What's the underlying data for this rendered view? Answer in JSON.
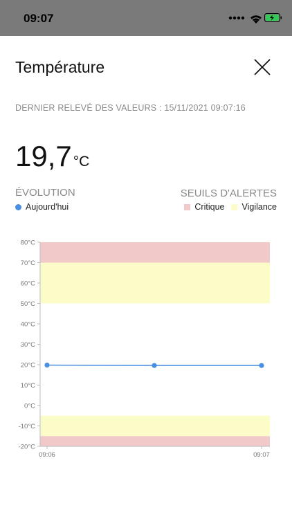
{
  "status_bar": {
    "time": "09:07"
  },
  "header": {
    "title": "Température"
  },
  "last_reading": {
    "text": "DERNIER RELEVÉ DES VALEURS : 15/11/2021 09:07:16"
  },
  "current": {
    "value": "19,7",
    "unit": "°C"
  },
  "evolution": {
    "heading": "ÉVOLUTION",
    "series_label": "Aujourd'hui",
    "series_color": "#4a90e2"
  },
  "thresholds": {
    "heading": "SEUILS D'ALERTES",
    "critical_label": "Critique",
    "critical_color": "#f2c9c9",
    "warning_label": "Vigilance",
    "warning_color": "#fbfcc8"
  },
  "chart_data": {
    "type": "line",
    "x": [
      "09:06",
      "09:06:30",
      "09:07"
    ],
    "x_tick_labels": [
      "09:06",
      "09:07"
    ],
    "series": [
      {
        "name": "Aujourd'hui",
        "values": [
          19.8,
          19.6,
          19.6
        ],
        "color": "#4a90e2"
      }
    ],
    "y_ticks": [
      "80°C",
      "70°C",
      "60°C",
      "50°C",
      "40°C",
      "30°C",
      "20°C",
      "10°C",
      "0°C",
      "-10°C",
      "-20°C"
    ],
    "ylim": [
      -20,
      80
    ],
    "bands": [
      {
        "from": 70,
        "to": 80,
        "kind": "critical",
        "color": "#f2c9c9"
      },
      {
        "from": 50,
        "to": 70,
        "kind": "warning",
        "color": "#fbfcc8"
      },
      {
        "from": -15,
        "to": -5,
        "kind": "warning",
        "color": "#fbfcc8"
      },
      {
        "from": -20,
        "to": -15,
        "kind": "critical",
        "color": "#f2c9c9"
      }
    ],
    "grid": false
  }
}
